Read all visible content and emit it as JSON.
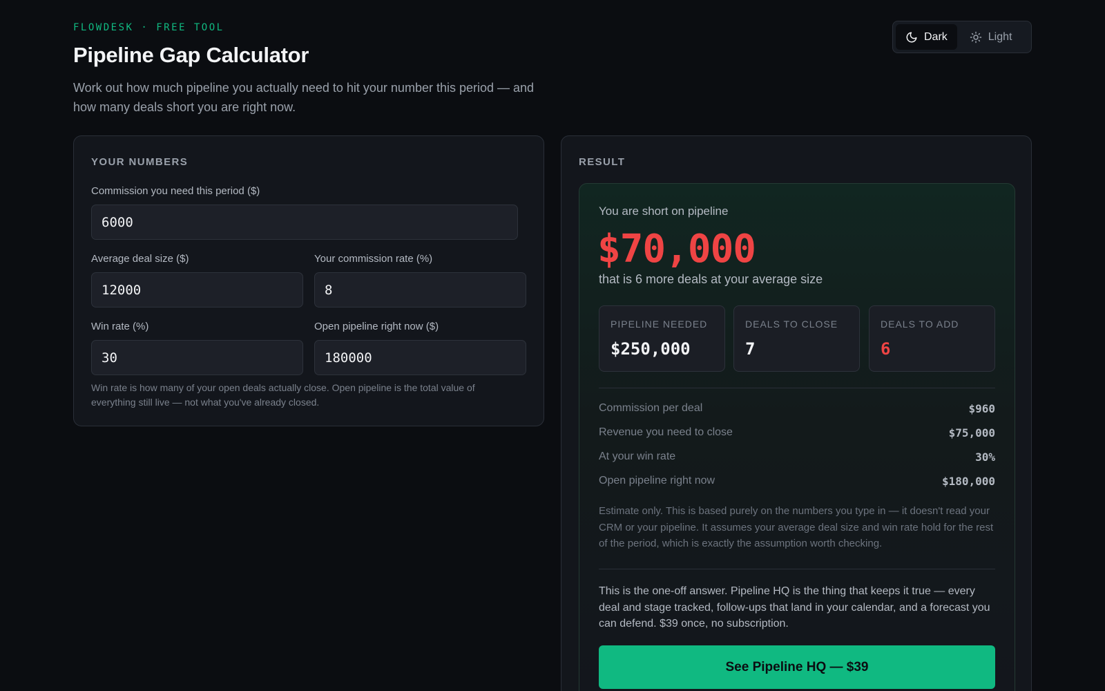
{
  "header": {
    "eyebrow": "FLOWDESK · FREE TOOL",
    "title": "Pipeline Gap Calculator",
    "description": "Work out how much pipeline you actually need to hit your number this period — and how many deals short you are right now."
  },
  "theme_toggle": {
    "selected": "Dark",
    "options": [
      {
        "label": "Dark",
        "icon": "moon-icon"
      },
      {
        "label": "Light",
        "icon": "sun-icon"
      }
    ]
  },
  "inputs_panel": {
    "title": "YOUR NUMBERS",
    "fields": {
      "commission_needed": {
        "label": "Commission you need this period ($)",
        "value": "6000"
      },
      "avg_deal_size": {
        "label": "Average deal size ($)",
        "value": "12000"
      },
      "commission_rate": {
        "label": "Your commission rate (%)",
        "value": "8"
      },
      "win_rate": {
        "label": "Win rate (%)",
        "value": "30"
      },
      "open_pipeline": {
        "label": "Open pipeline right now ($)",
        "value": "180000"
      }
    },
    "help_text": "Win rate is how many of your open deals actually close. Open pipeline is the total value of everything still live — not what you've already closed."
  },
  "result_panel": {
    "title": "RESULT",
    "status": "You are short on pipeline",
    "gap_amount": "$70,000",
    "gap_subtext": "that is 6 more deals at your average size",
    "stats": [
      {
        "label": "PIPELINE NEEDED",
        "value": "$250,000"
      },
      {
        "label": "DEALS TO CLOSE",
        "value": "7"
      },
      {
        "label": "DEALS TO ADD",
        "value": "6"
      }
    ],
    "breakdown": [
      {
        "label": "Commission per deal",
        "value": "$960"
      },
      {
        "label": "Revenue you need to close",
        "value": "$75,000"
      },
      {
        "label": "At your win rate",
        "value": "30%"
      },
      {
        "label": "Open pipeline right now",
        "value": "$180,000"
      }
    ],
    "disclaimer": "Estimate only. This is based purely on the numbers you type in — it doesn't read your CRM or your pipeline. It assumes your average deal size and win rate hold for the rest of the period, which is exactly the assumption worth checking.",
    "pitch": "This is the one-off answer. Pipeline HQ is the thing that keeps it true — every deal and stage tracked, follow-ups that land in your calendar, and a forecast you can defend. $39 once, no subscription.",
    "cta_label": "See Pipeline HQ — $39"
  },
  "colors": {
    "accent": "#10b981",
    "negative": "#ef4444",
    "background": "#0b0d11",
    "card": "#13161c"
  }
}
